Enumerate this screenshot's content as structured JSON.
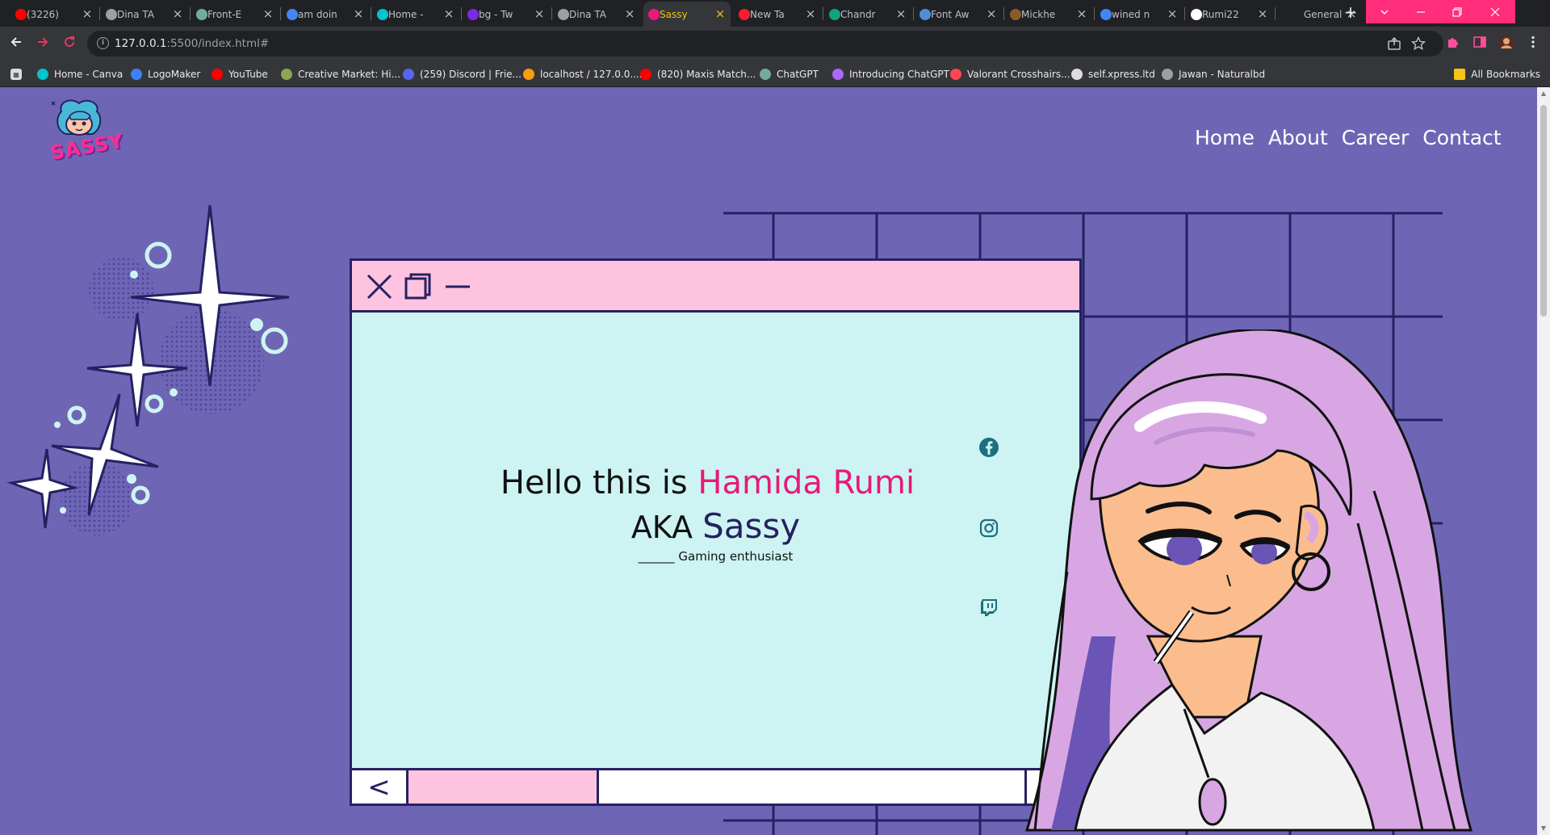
{
  "browser": {
    "tabs": [
      {
        "title": "(3226)",
        "favicon": "youtube-icon",
        "color": "#ff0000"
      },
      {
        "title": "Dina TA",
        "favicon": "globe-icon",
        "color": "#9aa0a6"
      },
      {
        "title": "Front-E",
        "favicon": "chatgpt-icon",
        "color": "#74aa9c"
      },
      {
        "title": "am doin",
        "favicon": "google-icon",
        "color": "#4285f4"
      },
      {
        "title": "Home -",
        "favicon": "canva-icon",
        "color": "#00c4cc"
      },
      {
        "title": "bg - Tw",
        "favicon": "canva-icon",
        "color": "#7d2ae8"
      },
      {
        "title": "Dina TA",
        "favicon": "globe-icon",
        "color": "#9aa0a6"
      },
      {
        "title": "Sassy",
        "favicon": "sassy-icon",
        "color": "#e8197a",
        "active": true
      },
      {
        "title": "New Ta",
        "favicon": "opera-icon",
        "color": "#ff1b2d"
      },
      {
        "title": "Chandr",
        "favicon": "openai-icon",
        "color": "#10a37f"
      },
      {
        "title": "Font Aw",
        "favicon": "flag-icon",
        "color": "#528dd7"
      },
      {
        "title": "Mickhe",
        "favicon": "book-icon",
        "color": "#8b5a2b"
      },
      {
        "title": "wined n",
        "favicon": "google-icon",
        "color": "#4285f4"
      },
      {
        "title": "Rumi22",
        "favicon": "github-icon",
        "color": "#ffffff"
      },
      {
        "title": "General",
        "favicon": "",
        "color": "#9aa0a6"
      }
    ],
    "url_host": "127.0.0.1",
    "url_rest": ":5500/index.html#",
    "bookmarks": [
      {
        "label": "Home - Canva",
        "icon": "canva-icon",
        "color": "#00c4cc"
      },
      {
        "label": "LogoMaker",
        "icon": "logomaker-icon",
        "color": "#3b82f6"
      },
      {
        "label": "YouTube",
        "icon": "youtube-icon",
        "color": "#ff0000"
      },
      {
        "label": "Creative Market: Hi...",
        "icon": "creative-market-icon",
        "color": "#8ba753"
      },
      {
        "label": "(259) Discord | Frie...",
        "icon": "discord-icon",
        "color": "#5865f2"
      },
      {
        "label": "localhost / 127.0.0....",
        "icon": "phpmyadmin-icon",
        "color": "#f89c0e"
      },
      {
        "label": "(820) Maxis Match...",
        "icon": "youtube-icon",
        "color": "#ff0000"
      },
      {
        "label": "ChatGPT",
        "icon": "chatgpt-icon",
        "color": "#74aa9c"
      },
      {
        "label": "Introducing ChatGPT",
        "icon": "openai-icon",
        "color": "#ab68ff"
      },
      {
        "label": "Valorant Crosshairs...",
        "icon": "valorant-icon",
        "color": "#ff4655"
      },
      {
        "label": "self.xpress.ltd",
        "icon": "page-icon",
        "color": "#dddddd"
      },
      {
        "label": "Jawan - Naturalbd",
        "icon": "globe-icon",
        "color": "#9aa0a6"
      }
    ],
    "all_bookmarks": "All Bookmarks"
  },
  "page": {
    "logo_text": "SASSY",
    "nav": [
      "Home",
      "About",
      "Career",
      "Contact"
    ],
    "hero": {
      "greeting": "Hello this is ",
      "name": "Hamida Rumi",
      "aka_prefix": "AKA ",
      "aka": "Sassy",
      "tagline": "______ Gaming enthusiast"
    },
    "footer_back": "<",
    "social": [
      "facebook-icon",
      "instagram-icon",
      "twitch-icon"
    ],
    "colors": {
      "background": "#6e66b5",
      "window": "#cdf4f2",
      "window_bar": "#fec3df",
      "outline": "#262162",
      "accent": "#e8197a"
    }
  }
}
